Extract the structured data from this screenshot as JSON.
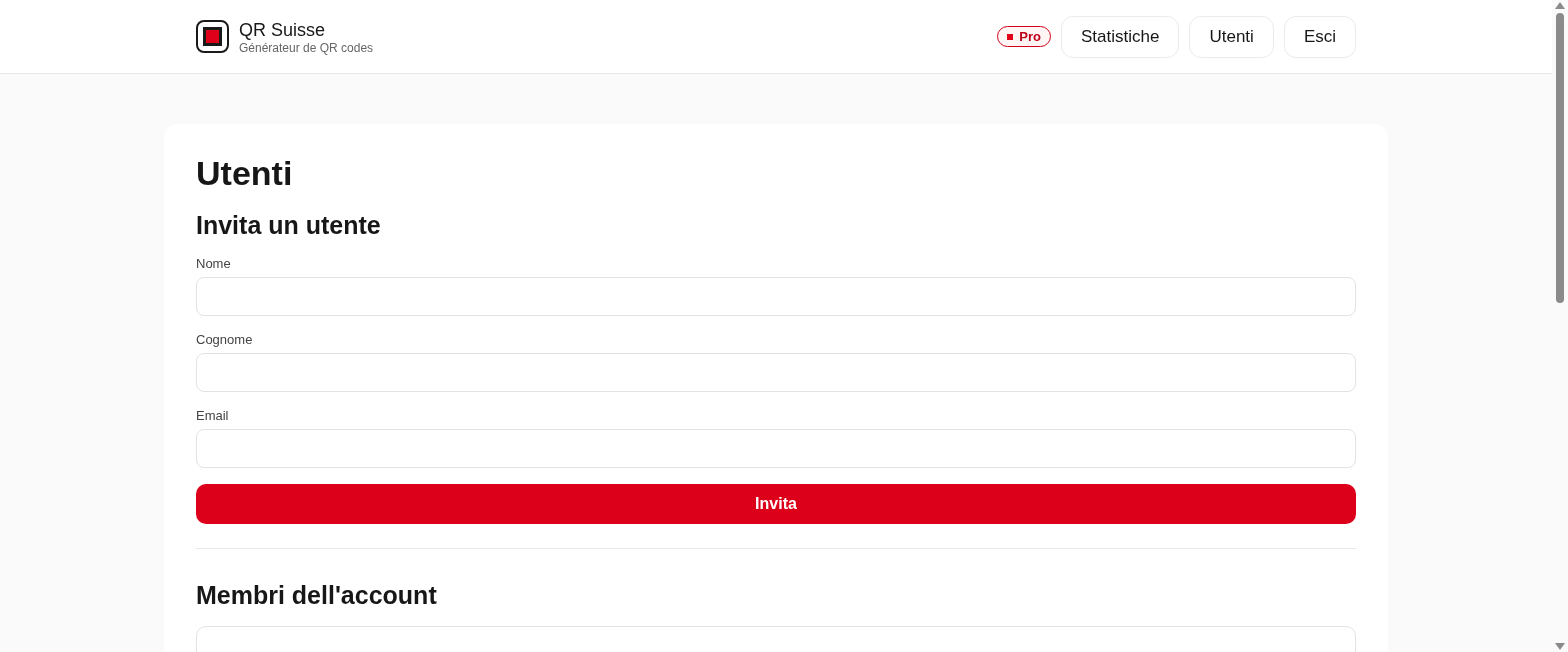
{
  "brand": {
    "title": "QR Suisse",
    "subtitle": "Générateur de QR codes"
  },
  "plan_badge": "Pro",
  "nav": [
    {
      "label": "Statistiche",
      "selected": false
    },
    {
      "label": "Utenti",
      "selected": false
    },
    {
      "label": "Esci",
      "selected": false
    }
  ],
  "page_title": "Utenti",
  "invite": {
    "heading": "Invita un utente",
    "fields": [
      {
        "label": "Nome"
      },
      {
        "label": "Cognome"
      },
      {
        "label": "Email"
      }
    ],
    "submit": "Invita"
  },
  "members": {
    "heading": "Membri dell'account"
  }
}
